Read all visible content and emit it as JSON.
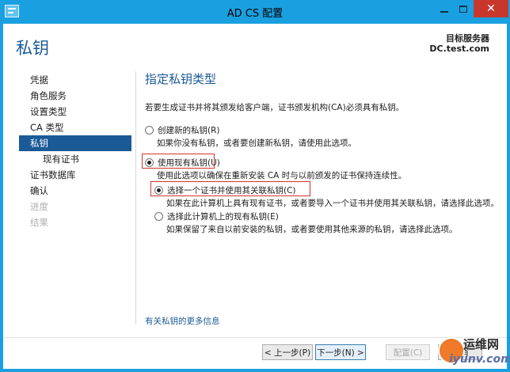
{
  "window": {
    "title": "AD CS 配置",
    "close_glyph": "✕"
  },
  "header": {
    "page_title": "私钥",
    "target_label": "目标服务器",
    "target_value": "DC.test.com"
  },
  "sidebar": {
    "items": [
      {
        "label": "凭据",
        "state": "normal"
      },
      {
        "label": "角色服务",
        "state": "normal"
      },
      {
        "label": "设置类型",
        "state": "normal"
      },
      {
        "label": "CA 类型",
        "state": "normal"
      },
      {
        "label": "私钥",
        "state": "active"
      },
      {
        "label": "现有证书",
        "state": "sub"
      },
      {
        "label": "证书数据库",
        "state": "normal"
      },
      {
        "label": "确认",
        "state": "normal"
      },
      {
        "label": "进度",
        "state": "disabled"
      },
      {
        "label": "结果",
        "state": "disabled"
      }
    ]
  },
  "main": {
    "section_title": "指定私钥类型",
    "description": "若要生成证书并将其颁发给客户端，证书颁发机构(CA)必须具有私钥。",
    "option_new": {
      "label": "创建新的私钥(R)",
      "hint": "如果你没有私钥，或者要创建新私钥，请使用此选项。",
      "checked": false
    },
    "option_existing": {
      "label": "使用现有私钥(U)",
      "hint": "使用此选项以确保在重新安装 CA 时与以前颁发的证书保持连续性。",
      "checked": true
    },
    "sub_option_cert": {
      "label": "选择一个证书并使用其关联私钥(C)",
      "hint": "如果在此计算机上具有现有证书，或者要导入一个证书并使用其关联私钥，请选择此选项。",
      "checked": true
    },
    "sub_option_key": {
      "label": "选择此计算机上的现有私钥(E)",
      "hint": "如果保留了来自以前安装的私钥，或者要使用其他来源的私钥，请选择此选项。",
      "checked": false
    },
    "help_link": "有关私钥的更多信息"
  },
  "footer": {
    "prev_label": "< 上一步(P)",
    "next_label": "下一步(N) >",
    "configure_label": "配置(C)",
    "cancel_label": "取消"
  },
  "watermark": {
    "top": "运维网",
    "bottom": "iyunv.com"
  },
  "colors": {
    "title_bar": "#1aa0e0",
    "accent": "#1a5a97",
    "highlight_border": "#d0342c"
  }
}
